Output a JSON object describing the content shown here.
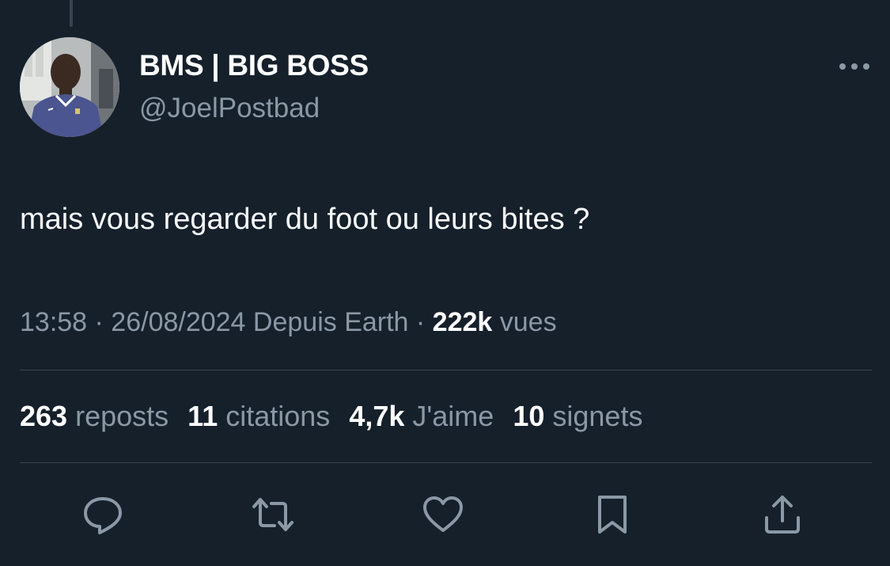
{
  "author": {
    "display_name": "BMS | BIG BOSS",
    "handle": "@JoelPostbad",
    "avatar_icon": "profile-photo"
  },
  "tweet": {
    "text": "mais vous regarder du foot ou leurs bites ?"
  },
  "meta": {
    "timestamp": "13:58 · 26/08/2024 Depuis Earth · ",
    "views_count": "222k",
    "views_label": "vues"
  },
  "stats": {
    "reposts_count": "263",
    "reposts_label": "reposts",
    "quotes_count": "11",
    "quotes_label": "citations",
    "likes_count": "4,7k",
    "likes_label": "J'aime",
    "bookmarks_count": "10",
    "bookmarks_label": "signets"
  },
  "actions": {
    "reply_icon": "reply-icon",
    "repost_icon": "repost-icon",
    "like_icon": "heart-icon",
    "bookmark_icon": "bookmark-icon",
    "share_icon": "share-icon"
  },
  "colors": {
    "background": "#15202b",
    "text_primary": "#e7e9ea",
    "text_secondary": "#8b98a5",
    "divider": "#38444d"
  }
}
